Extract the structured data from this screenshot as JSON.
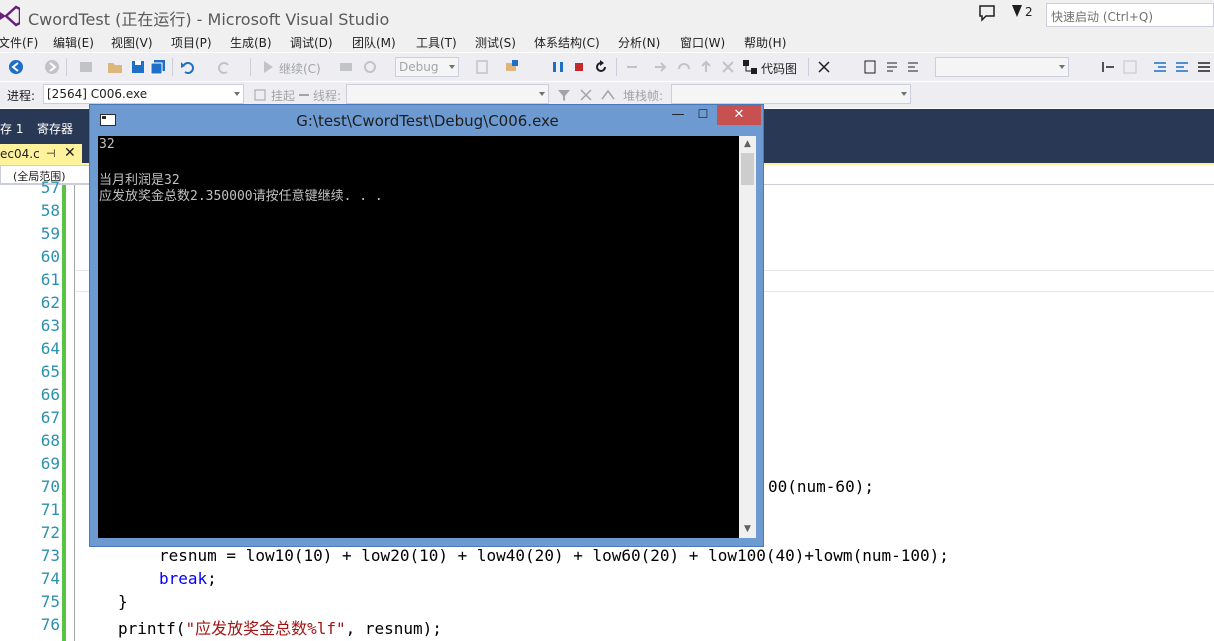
{
  "window": {
    "title": "CwordTest (正在运行) - Microsoft Visual Studio",
    "notification_count": "2",
    "quick_launch_placeholder": "快速启动 (Ctrl+Q)"
  },
  "menu": [
    "文件(F)",
    "编辑(E)",
    "视图(V)",
    "项目(P)",
    "生成(B)",
    "调试(D)",
    "团队(M)",
    "工具(T)",
    "测试(S)",
    "体系结构(C)",
    "分析(N)",
    "窗口(W)",
    "帮助(H)"
  ],
  "toolbar1": {
    "continue_label": "继续(C)",
    "config_value": "Debug",
    "code_map_label": "代码图"
  },
  "toolbar2": {
    "process_label": "进程:",
    "process_value": "[2564] C006.exe",
    "suspend_label": "挂起",
    "thread_label": "线程:",
    "stack_frame_label": "堆栈帧:"
  },
  "tool_tabs": [
    "存 1",
    "寄存器"
  ],
  "doc_tab": {
    "label": "ec04.c",
    "pin": "⊣",
    "close": "✕"
  },
  "navbar": {
    "scope": "(全局范围)"
  },
  "editor": {
    "line_numbers": [
      "57",
      "58",
      "59",
      "60",
      "61",
      "62",
      "63",
      "64",
      "65",
      "66",
      "67",
      "68",
      "69",
      "70",
      "71",
      "72",
      "73",
      "74",
      "75",
      "76"
    ],
    "line70_tail": "00(num-60);",
    "line73": "resnum = low10(10) + low20(10) + low40(20) + low60(20) + low100(40)+lowm(num-100);",
    "line74_kw": "break",
    "line74_rest": ";",
    "line75": "}",
    "line76_func": "printf(",
    "line76_str": "\"应发放奖金总数%lf\"",
    "line76_rest": ", resnum);"
  },
  "console": {
    "title": "G:\\test\\CwordTest\\Debug\\C006.exe",
    "min": "—",
    "max": "☐",
    "close": "✕",
    "lines": [
      "32",
      "",
      "当月利润是32",
      "应发放奖金总数2.350000请按任意键继续. . ."
    ]
  },
  "colors": {
    "accent_tab": "#fff29d",
    "tool_strip": "#293955",
    "line_numbers": "#2b91af",
    "keyword": "#0000ff",
    "string": "#a31515",
    "change_bar": "#57c443",
    "console_frame": "#6d9ad1",
    "close_button": "#c75050"
  }
}
